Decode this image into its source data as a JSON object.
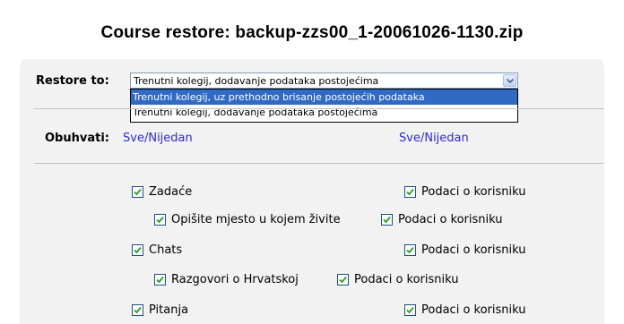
{
  "page": {
    "title": "Course restore: backup-zzs00_1-20061026-1130.zip"
  },
  "restore_to": {
    "label": "Restore to:",
    "selected_value": "Trenutni kolegij, dodavanje podataka postojećima",
    "options": [
      "Trenutni kolegij, uz prethodno brisanje postojećih podataka",
      "Trenutni kolegij, dodavanje podataka postojećima"
    ],
    "highlighted_option": 0
  },
  "include": {
    "label": "Obuhvati:",
    "left_links": {
      "all": "Sve",
      "separator": "/",
      "none": "Nijedan"
    },
    "right_links": {
      "all": "Sve",
      "separator": "/",
      "none": "Nijedan"
    }
  },
  "modules": [
    {
      "name": "Zadaće",
      "checked": true,
      "user_data_label": "Podaci o korisniku",
      "user_data_checked": true
    },
    {
      "name": "Opišite mjesto u kojem živite",
      "checked": true,
      "user_data_label": "Podaci o korisniku",
      "user_data_checked": true
    },
    {
      "name": "Chats",
      "checked": true,
      "user_data_label": "Podaci o korisniku",
      "user_data_checked": true
    },
    {
      "name": "Razgovori o Hrvatskoj",
      "checked": true,
      "user_data_label": "Podaci o korisniku",
      "user_data_checked": true
    },
    {
      "name": "Pitanja",
      "checked": true,
      "user_data_label": "Podaci o korisniku",
      "user_data_checked": true
    }
  ],
  "colors": {
    "panel_bg": "#f2f2f2",
    "link": "#2a2ae0",
    "selection": "#316ac5",
    "checkbox_border": "#1c5180",
    "checkmark": "#21a121"
  },
  "icons": {
    "dropdown_arrow": "chevron-down-icon",
    "checkbox": "checkbox-checked-icon"
  }
}
